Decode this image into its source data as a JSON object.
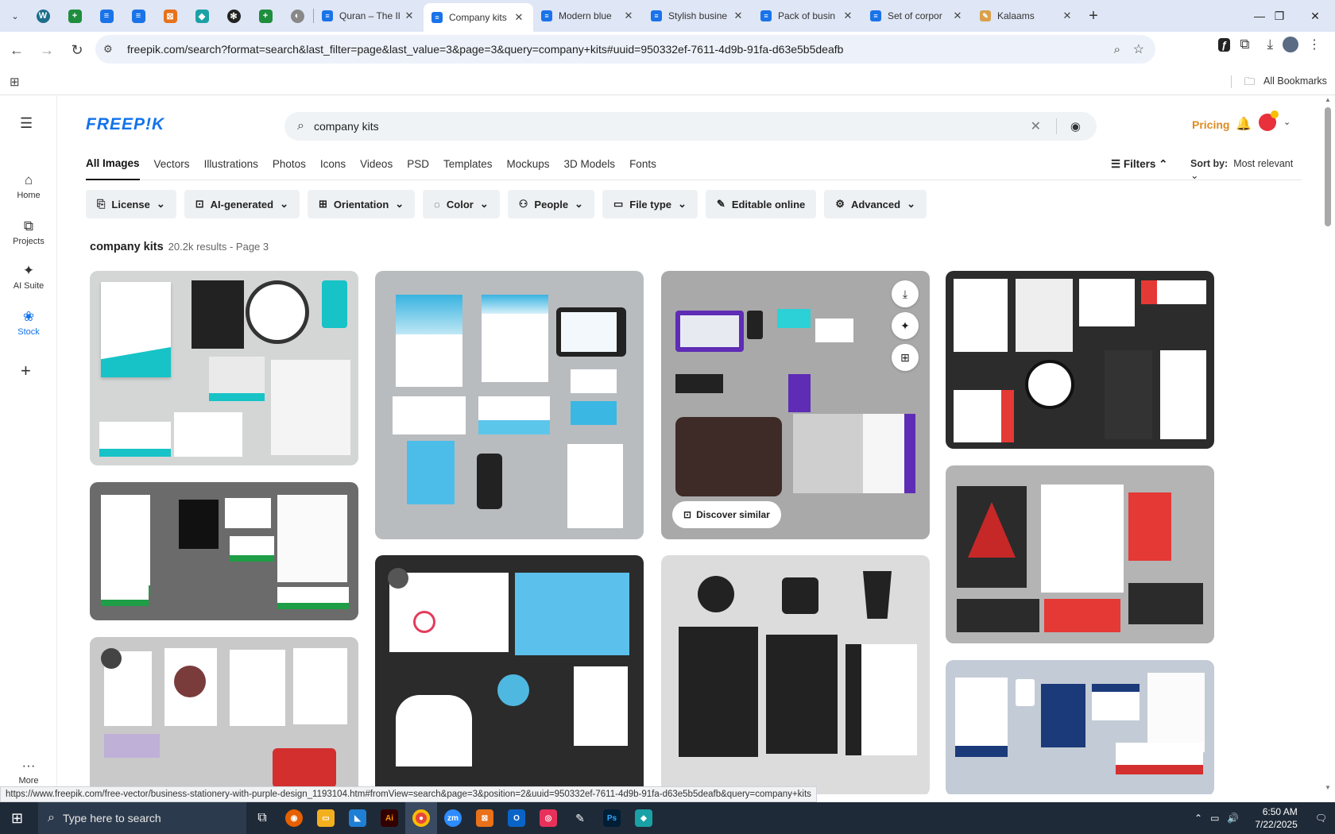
{
  "browser": {
    "tabs": [
      {
        "title": "Quran – The Il",
        "favicon": "docs-icon"
      },
      {
        "title": "Company kits",
        "favicon": "docs-icon",
        "active": true
      },
      {
        "title": "Modern blue",
        "favicon": "docs-icon"
      },
      {
        "title": "Stylish busine",
        "favicon": "docs-icon"
      },
      {
        "title": "Pack of busin",
        "favicon": "docs-icon"
      },
      {
        "title": "Set of corpor",
        "favicon": "docs-icon"
      },
      {
        "title": "Kalaams",
        "favicon": "kalaams-icon"
      }
    ],
    "url": "freepik.com/search?format=search&last_filter=page&last_value=3&page=3&query=company+kits#uuid=950332ef-7611-4d9b-91fa-d63e5b5deafb",
    "bookmarks_label": "All Bookmarks"
  },
  "rail": {
    "items": [
      {
        "label": "Home",
        "icon": "home-icon"
      },
      {
        "label": "Projects",
        "icon": "projects-icon"
      },
      {
        "label": "AI Suite",
        "icon": "ai-suite-icon"
      },
      {
        "label": "Stock",
        "icon": "stock-icon"
      }
    ],
    "more_label": "More"
  },
  "header": {
    "logo": "FREEP!K",
    "search_value": "company kits",
    "pricing": "Pricing"
  },
  "type_tabs": [
    "All Images",
    "Vectors",
    "Illustrations",
    "Photos",
    "Icons",
    "Videos",
    "PSD",
    "Templates",
    "Mockups",
    "3D Models",
    "Fonts"
  ],
  "filters_label": "Filters",
  "sort": {
    "label": "Sort by:",
    "value": "Most relevant"
  },
  "chips": [
    "License",
    "AI-generated",
    "Orientation",
    "Color",
    "People",
    "File type",
    "Editable online",
    "Advanced"
  ],
  "results": {
    "query": "company kits",
    "summary": "20.2k results - Page 3"
  },
  "card_actions": {
    "discover_label": "Discover similar"
  },
  "status_url": "https://www.freepik.com/free-vector/business-stationery-with-purple-design_1193104.htm#fromView=search&page=3&position=2&uuid=950332ef-7611-4d9b-91fa-d63e5b5deafb&query=company+kits",
  "taskbar": {
    "search_placeholder": "Type here to search",
    "time": "6:50 AM",
    "date": "7/22/2025"
  },
  "colors": {
    "brand": "#1273eb",
    "pricing": "#e08a1f",
    "accent_teal": "#17c3c6"
  }
}
